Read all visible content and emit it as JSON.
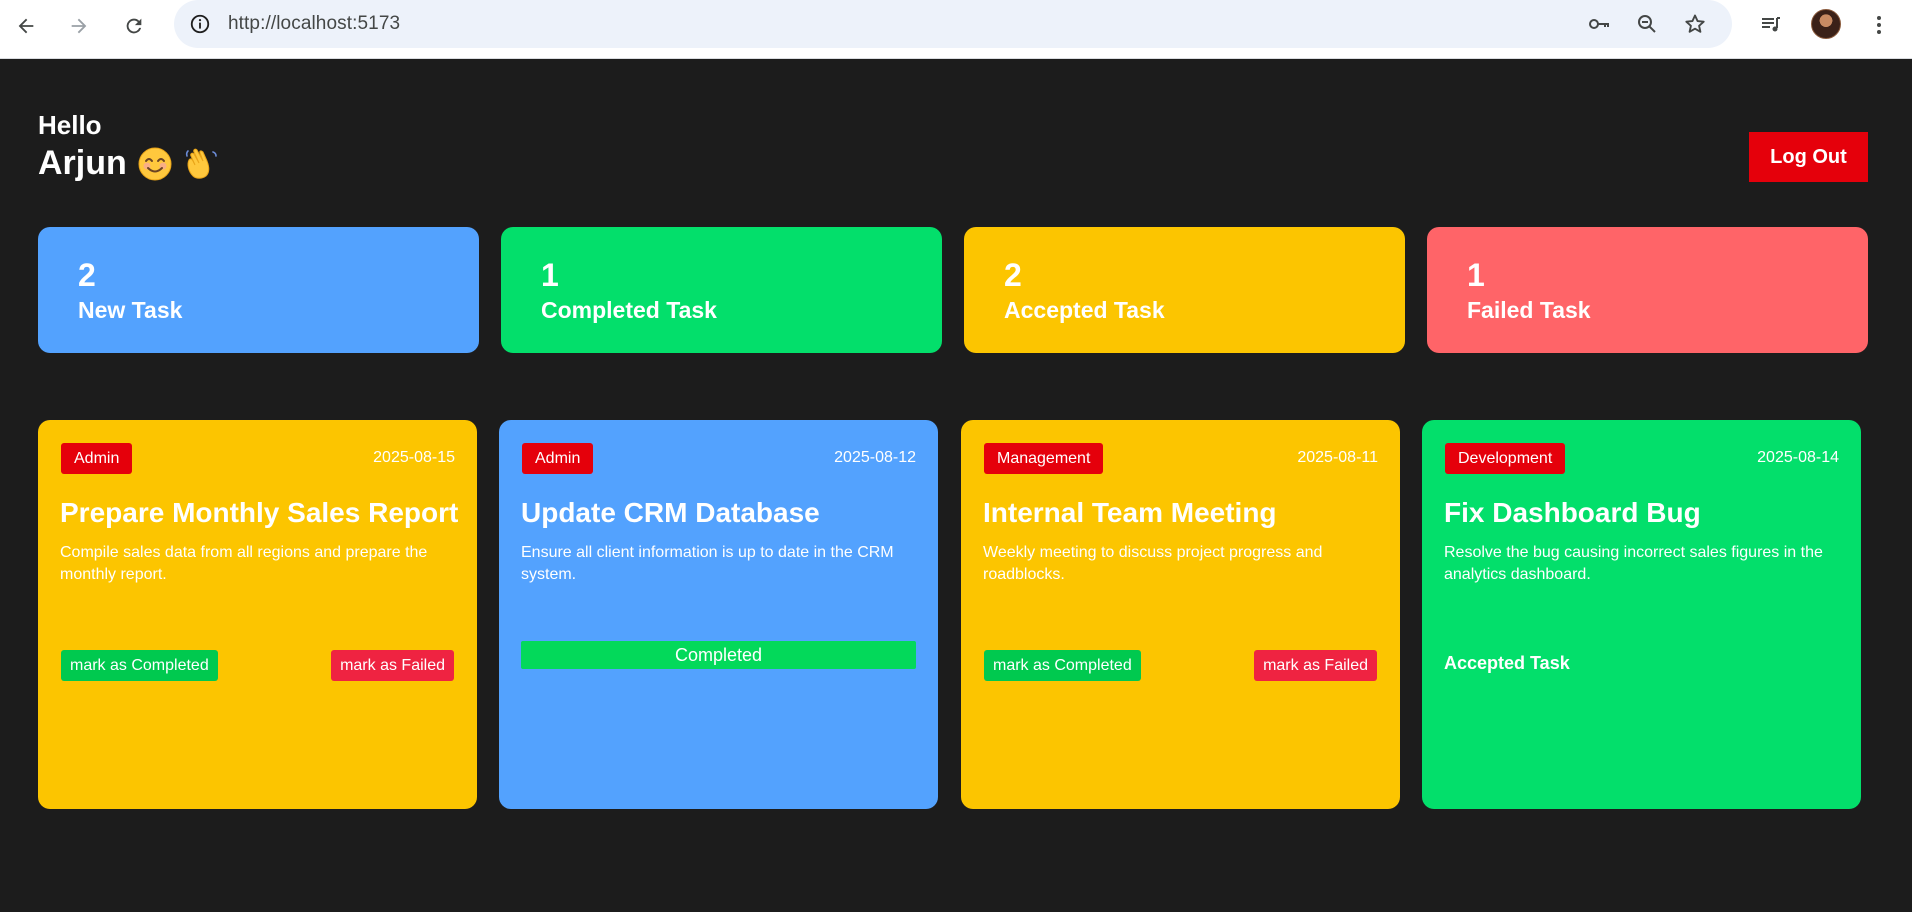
{
  "browser": {
    "url": "http://localhost:5173",
    "icons": [
      "back-arrow-icon",
      "forward-arrow-icon",
      "reload-icon",
      "site-info-icon",
      "password-key-icon",
      "zoom-icon",
      "bookmark-star-icon",
      "media-controls-icon",
      "profile-avatar",
      "more-menu-icon"
    ]
  },
  "header": {
    "hello": "Hello",
    "name": "Arjun",
    "logout_label": "Log Out"
  },
  "stats": [
    {
      "count": "2",
      "label": "New Task",
      "color": "#53a2fe"
    },
    {
      "count": "1",
      "label": "Completed Task",
      "color": "#03df6b"
    },
    {
      "count": "2",
      "label": "Accepted Task",
      "color": "#fcc500"
    },
    {
      "count": "1",
      "label": "Failed Task",
      "color": "#ff6468"
    }
  ],
  "tasks": [
    {
      "category": "Admin",
      "date": "2025-08-15",
      "title": "Prepare Monthly Sales Report",
      "description": "Compile sales data from all regions and prepare the monthly report.",
      "complete_label": "mark as Completed",
      "fail_label": "mark as Failed",
      "color": "#fcc500"
    },
    {
      "category": "Admin",
      "date": "2025-08-12",
      "title": "Update CRM Database",
      "description": "Ensure all client information is up to date in the CRM system.",
      "status_label": "Completed",
      "color": "#53a2fe"
    },
    {
      "category": "Management",
      "date": "2025-08-11",
      "title": "Internal Team Meeting",
      "description": "Weekly meeting to discuss project progress and roadblocks.",
      "complete_label": "mark as Completed",
      "fail_label": "mark as Failed",
      "color": "#fcc500"
    },
    {
      "category": "Development",
      "date": "2025-08-14",
      "title": "Fix Dashboard Bug",
      "description": "Resolve the bug causing incorrect sales figures in the analytics dashboard.",
      "status_label": "Accepted Task",
      "color": "#03df6b"
    }
  ]
}
